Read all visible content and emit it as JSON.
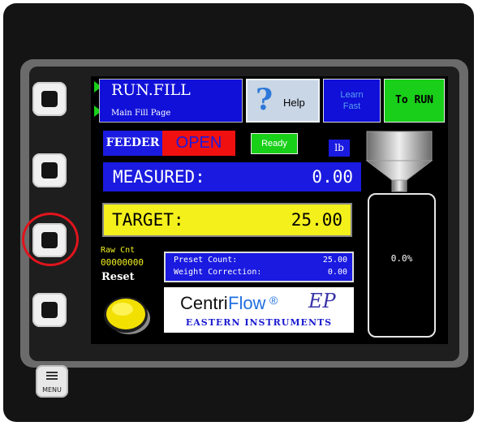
{
  "header": {
    "page_title": "RUN.FILL",
    "page_subtitle": "Main Fill Page",
    "help": {
      "icon": "question-mark-icon",
      "label": "Help"
    },
    "learn_fast": {
      "line1": "Learn",
      "line2": "Fast"
    },
    "to_run": "To RUN"
  },
  "status": {
    "feeder_label": "FEEDER",
    "feeder_state": "OPEN",
    "ready": "Ready",
    "unit": "lb"
  },
  "measured": {
    "label": "MEASURED:",
    "value": "0.00"
  },
  "target": {
    "label": "TARGET:",
    "value": "25.00"
  },
  "fill_gauge": {
    "percent_label": "0.0%",
    "level": 0.0
  },
  "raw_count": {
    "label": "Raw Cnt",
    "value": "00000000"
  },
  "reset": {
    "label": "Reset",
    "icon": "round-yellow-button-icon"
  },
  "preset": {
    "count_label": "Preset Count:",
    "count_value": "25.00",
    "weight_label": "Weight Correction:",
    "weight_value": "0.00"
  },
  "logo": {
    "centri": "Centri",
    "flow": "Flow",
    "reg": "®",
    "mark": "EP",
    "company": "EASTERN INSTRUMENTS"
  },
  "device": {
    "menu_label": "MENU",
    "menu_icon": "menu-icon"
  },
  "colors": {
    "screen_blue": "#1a1ae0",
    "run_green": "#19cf19",
    "open_red": "#f01010",
    "target_yellow": "#f4f01c",
    "highlight_red": "#e0141c"
  }
}
